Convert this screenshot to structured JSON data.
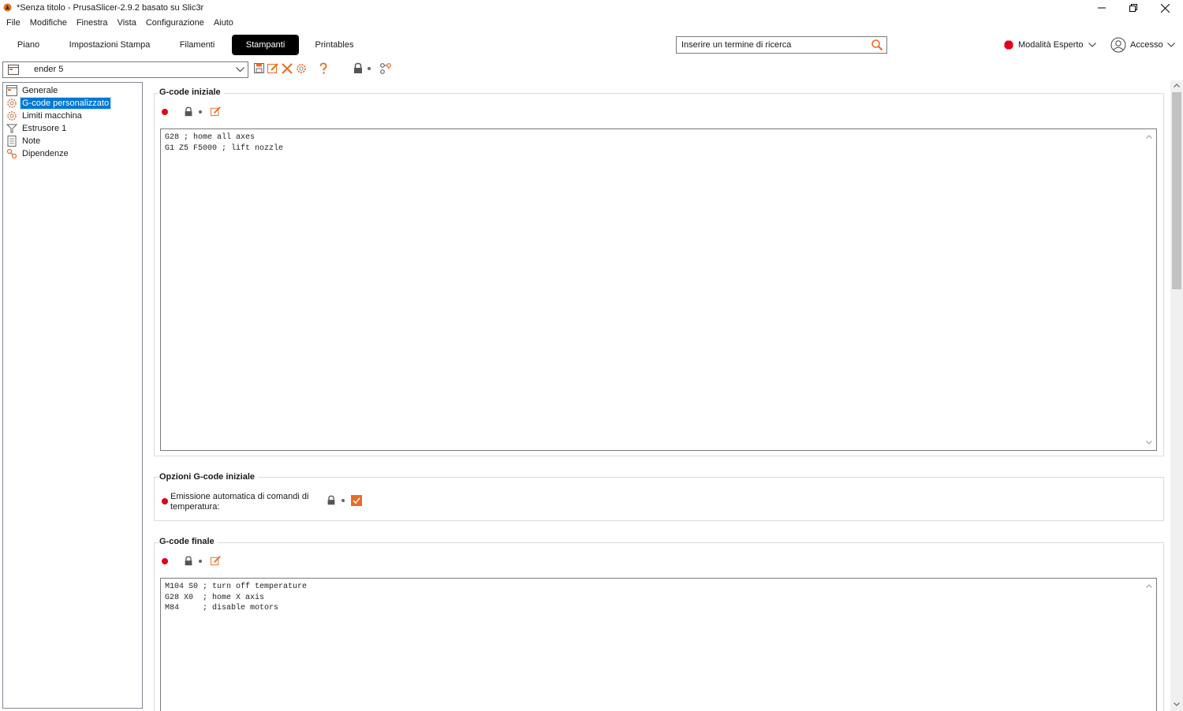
{
  "window": {
    "title": "*Senza titolo - PrusaSlicer-2.9.2 basato su Slic3r"
  },
  "menubar": [
    "File",
    "Modifiche",
    "Finestra",
    "Vista",
    "Configurazione",
    "Aiuto"
  ],
  "tabs": [
    {
      "label": "Piano",
      "active": false
    },
    {
      "label": "Impostazioni Stampa",
      "active": false
    },
    {
      "label": "Filamenti",
      "active": false
    },
    {
      "label": "Stampanti",
      "active": true
    },
    {
      "label": "Printables",
      "active": false
    }
  ],
  "search": {
    "placeholder": "Inserire un termine di ricerca"
  },
  "mode": {
    "label": "Modalità Esperto",
    "color": "#e0001a"
  },
  "account": {
    "label": "Accesso"
  },
  "preset": {
    "name": "ender 5"
  },
  "sidebar": {
    "items": [
      {
        "label": "Generale",
        "icon": "printer-icon",
        "selected": false
      },
      {
        "label": "G-code personalizzato",
        "icon": "cog-icon",
        "selected": true
      },
      {
        "label": "Limiti macchina",
        "icon": "cog-icon",
        "selected": false
      },
      {
        "label": "Estrusore 1",
        "icon": "funnel-icon",
        "selected": false
      },
      {
        "label": "Note",
        "icon": "note-icon",
        "selected": false
      },
      {
        "label": "Dipendenze",
        "icon": "dependency-icon",
        "selected": false
      }
    ]
  },
  "start_gcode": {
    "title": "G-code iniziale",
    "code": "G28 ; home all axes\nG1 Z5 F5000 ; lift nozzle"
  },
  "start_options": {
    "title": "Opzioni G-code iniziale",
    "option_line1": "Emissione automatica di comandi di",
    "option_line2": "temperatura:",
    "checked": true
  },
  "end_gcode": {
    "title": "G-code finale",
    "code": "M104 S0 ; turn off temperature\nG28 X0  ; home X axis\nM84     ; disable motors"
  },
  "colors": {
    "accent": "#ed6b21",
    "selection": "#0078d7",
    "modified": "#e0001a"
  }
}
